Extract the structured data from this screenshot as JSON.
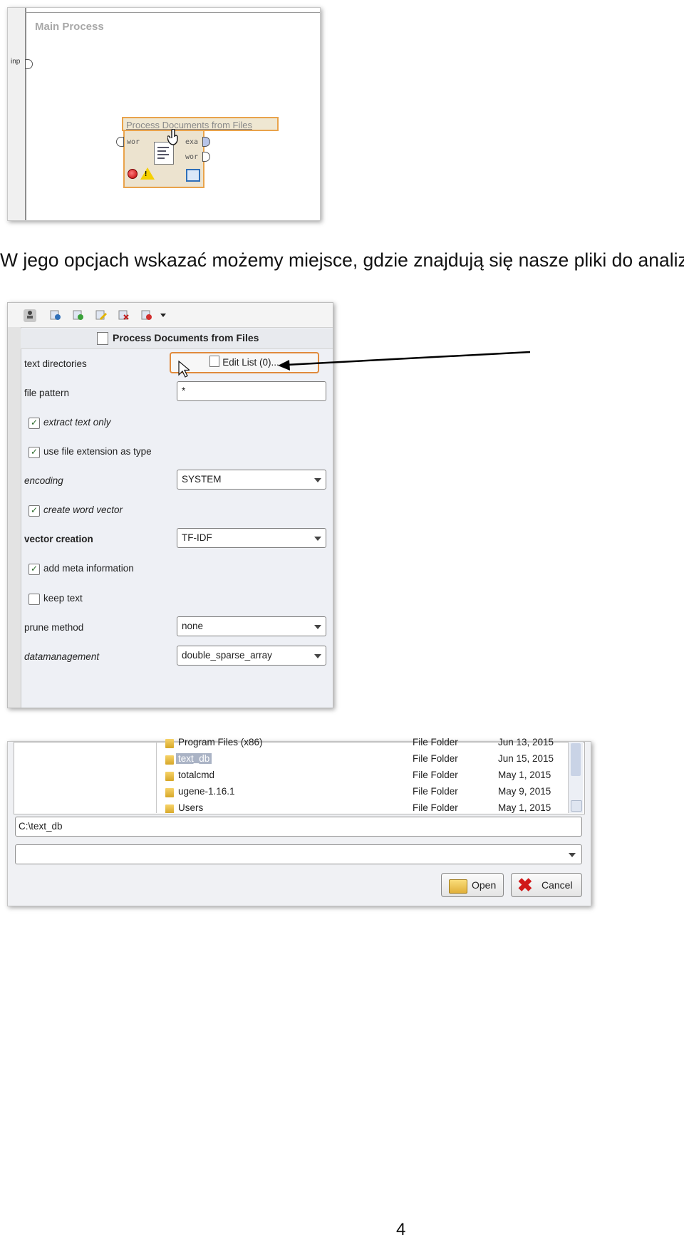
{
  "process_canvas": {
    "title": "Main Process",
    "input_port_label": "inp",
    "operator": {
      "name": "Process Documents from Files",
      "input_port": "wor",
      "output_ports": [
        "exa",
        "wor"
      ],
      "status": [
        "error",
        "warning"
      ]
    }
  },
  "caption": "W jego opcjach wskazać możemy miejsce, gdzie znajdują się nasze pliki do analizy.",
  "parameters_panel": {
    "title": "Process Documents from Files",
    "toolbar_icons": [
      "expert-mode-icon",
      "info-icon",
      "check-icon",
      "edit-icon",
      "remove-icon",
      "delete-icon",
      "dropdown-arrow-icon"
    ],
    "params": {
      "text_directories": {
        "label": "text directories",
        "button": "Edit List (0)..."
      },
      "file_pattern": {
        "label": "file pattern",
        "value": "*"
      },
      "extract_text_only": {
        "label": "extract text only",
        "checked": true
      },
      "use_file_extension": {
        "label": "use file extension as type",
        "checked": true
      },
      "encoding": {
        "label": "encoding",
        "value": "SYSTEM"
      },
      "create_word_vector": {
        "label": "create word vector",
        "checked": true
      },
      "vector_creation": {
        "label": "vector creation",
        "value": "TF-IDF"
      },
      "add_meta_information": {
        "label": "add meta information",
        "checked": true
      },
      "keep_text": {
        "label": "keep text",
        "checked": false
      },
      "prune_method": {
        "label": "prune method",
        "value": "none"
      },
      "datamanagement": {
        "label": "datamanagement",
        "value": "double_sparse_array"
      }
    },
    "check_mark": "✓"
  },
  "file_chooser": {
    "rows": [
      {
        "name": "Program Files (x86)",
        "type": "File Folder",
        "date": "Jun 13, 2015",
        "selected": false
      },
      {
        "name": "text_db",
        "type": "File Folder",
        "date": "Jun 15, 2015",
        "selected": true
      },
      {
        "name": "totalcmd",
        "type": "File Folder",
        "date": "May 1, 2015",
        "selected": false
      },
      {
        "name": "ugene-1.16.1",
        "type": "File Folder",
        "date": "May 9, 2015",
        "selected": false
      },
      {
        "name": "Users",
        "type": "File Folder",
        "date": "May 1, 2015",
        "selected": false
      }
    ],
    "path": "C:\\text_db",
    "filter": "",
    "open_label": "Open",
    "cancel_label": "Cancel"
  },
  "page_number": "4"
}
